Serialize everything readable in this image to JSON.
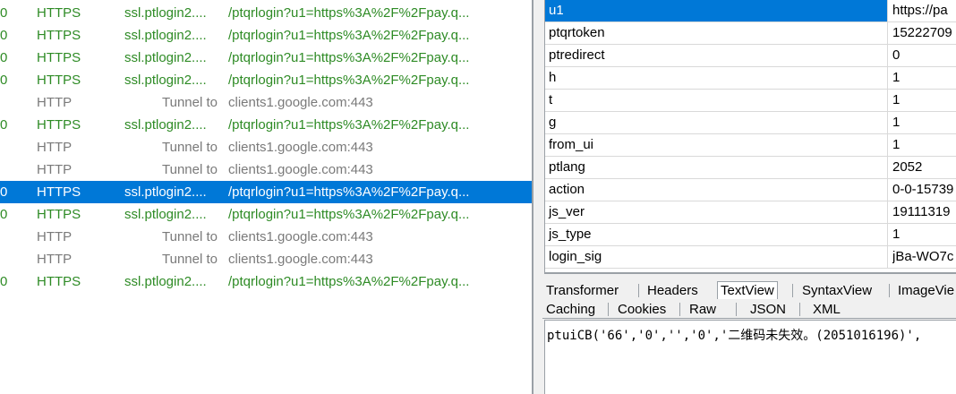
{
  "sessions": [
    {
      "num": "0",
      "protocol": "HTTPS",
      "host": "ssl.ptlogin2....",
      "url": "/ptqrlogin?u1=https%3A%2F%2Fpay.q...",
      "kind": "https"
    },
    {
      "num": "0",
      "protocol": "HTTPS",
      "host": "ssl.ptlogin2....",
      "url": "/ptqrlogin?u1=https%3A%2F%2Fpay.q...",
      "kind": "https"
    },
    {
      "num": "0",
      "protocol": "HTTPS",
      "host": "ssl.ptlogin2....",
      "url": "/ptqrlogin?u1=https%3A%2F%2Fpay.q...",
      "kind": "https"
    },
    {
      "num": "0",
      "protocol": "HTTPS",
      "host": "ssl.ptlogin2....",
      "url": "/ptqrlogin?u1=https%3A%2F%2Fpay.q...",
      "kind": "https"
    },
    {
      "num": "",
      "protocol": "HTTP",
      "host": "Tunnel to",
      "url": "clients1.google.com:443",
      "kind": "tunnel"
    },
    {
      "num": "0",
      "protocol": "HTTPS",
      "host": "ssl.ptlogin2....",
      "url": "/ptqrlogin?u1=https%3A%2F%2Fpay.q...",
      "kind": "https"
    },
    {
      "num": "",
      "protocol": "HTTP",
      "host": "Tunnel to",
      "url": "clients1.google.com:443",
      "kind": "tunnel"
    },
    {
      "num": "",
      "protocol": "HTTP",
      "host": "Tunnel to",
      "url": "clients1.google.com:443",
      "kind": "tunnel"
    },
    {
      "num": "0",
      "protocol": "HTTPS",
      "host": "ssl.ptlogin2....",
      "url": "/ptqrlogin?u1=https%3A%2F%2Fpay.q...",
      "kind": "selected"
    },
    {
      "num": "0",
      "protocol": "HTTPS",
      "host": "ssl.ptlogin2....",
      "url": "/ptqrlogin?u1=https%3A%2F%2Fpay.q...",
      "kind": "https"
    },
    {
      "num": "",
      "protocol": "HTTP",
      "host": "Tunnel to",
      "url": "clients1.google.com:443",
      "kind": "tunnel"
    },
    {
      "num": "",
      "protocol": "HTTP",
      "host": "Tunnel to",
      "url": "clients1.google.com:443",
      "kind": "tunnel"
    },
    {
      "num": "0",
      "protocol": "HTTPS",
      "host": "ssl.ptlogin2....",
      "url": "/ptqrlogin?u1=https%3A%2F%2Fpay.q...",
      "kind": "https"
    }
  ],
  "params": [
    {
      "key": "u1",
      "value": "https://pa",
      "selected": true
    },
    {
      "key": "ptqrtoken",
      "value": "15222709"
    },
    {
      "key": "ptredirect",
      "value": "0"
    },
    {
      "key": "h",
      "value": "1"
    },
    {
      "key": "t",
      "value": "1"
    },
    {
      "key": "g",
      "value": "1"
    },
    {
      "key": "from_ui",
      "value": "1"
    },
    {
      "key": "ptlang",
      "value": "2052"
    },
    {
      "key": "action",
      "value": "0-0-15739"
    },
    {
      "key": "js_ver",
      "value": "19111319"
    },
    {
      "key": "js_type",
      "value": "1"
    },
    {
      "key": "login_sig",
      "value": "jBa-WO7c"
    }
  ],
  "tabs_top": [
    "Transformer",
    "Headers",
    "TextView",
    "SyntaxView",
    "ImageVie"
  ],
  "tabs_bottom": [
    "Caching",
    "Cookies",
    "Raw",
    "JSON",
    "XML"
  ],
  "active_tab": "TextView",
  "textview": "ptuiCB('66','0','','0','二维码未失效。(2051016196)',",
  "colors": {
    "selection": "#0078d7",
    "https_text": "#2e8b25",
    "tunnel_text": "#7a7a7a"
  }
}
